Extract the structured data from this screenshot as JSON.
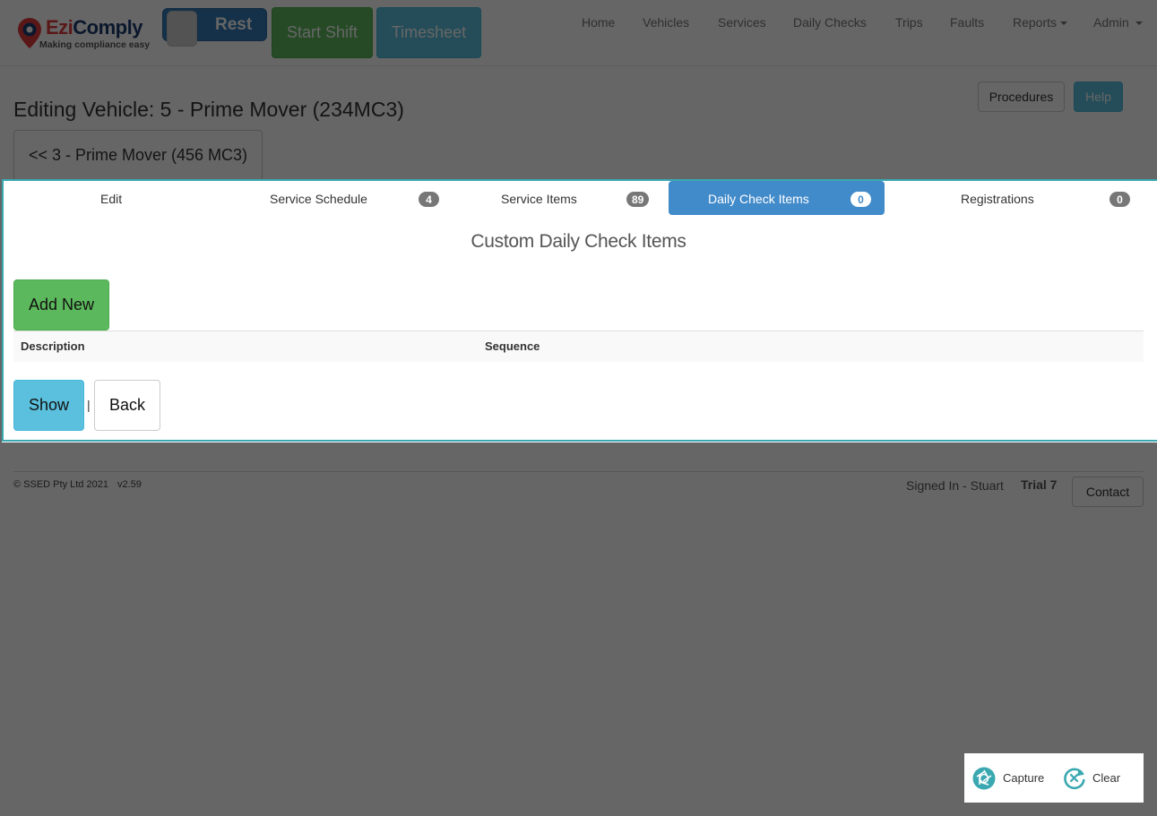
{
  "brand": {
    "name_part1": "Ezi",
    "name_part2": "Comply",
    "tagline": "Making compliance easy",
    "colors": {
      "red": "#e03a3e",
      "navy": "#1c3b6e"
    }
  },
  "toolbar": {
    "status_toggle_label": "Rest",
    "start_shift_label": "Start Shift",
    "timesheet_label": "Timesheet"
  },
  "nav": {
    "home": "Home",
    "vehicles": "Vehicles",
    "services": "Services",
    "daily_checks": "Daily Checks",
    "trips": "Trips",
    "faults": "Faults",
    "reports": "Reports",
    "admin": "Admin"
  },
  "page": {
    "title": "Editing Vehicle: 5 - Prime Mover (234MC3)",
    "procedures_label": "Procedures",
    "help_label": "Help",
    "previous_vehicle_label": "<< 3 - Prime Mover (456 MC3)"
  },
  "tabs": [
    {
      "label": "Edit",
      "badge": null,
      "active": false
    },
    {
      "label": "Service Schedule",
      "badge": "4",
      "active": false
    },
    {
      "label": "Service Items",
      "badge": "89",
      "active": false
    },
    {
      "label": "Daily Check Items",
      "badge": "0",
      "active": true
    },
    {
      "label": "Registrations",
      "badge": "0",
      "active": false
    }
  ],
  "content": {
    "section_title": "Custom Daily Check Items",
    "add_new_label": "Add New",
    "table": {
      "columns": [
        "Description",
        "Sequence"
      ],
      "rows": []
    },
    "show_label": "Show",
    "separator": "|",
    "back_label": "Back"
  },
  "footer": {
    "copyright": "© SSED Pty Ltd 2021",
    "version": "v2.59",
    "signed_in": "Signed In - Stuart",
    "plan": "Trial 7",
    "contact_label": "Contact"
  },
  "capture_widget": {
    "capture_label": "Capture",
    "clear_label": "Clear",
    "accent_color": "#3aa8b0"
  },
  "colors": {
    "primary": "#428bca",
    "success": "#5cb85c",
    "info": "#5bc0de",
    "highlight_border": "#3aa8b0"
  }
}
